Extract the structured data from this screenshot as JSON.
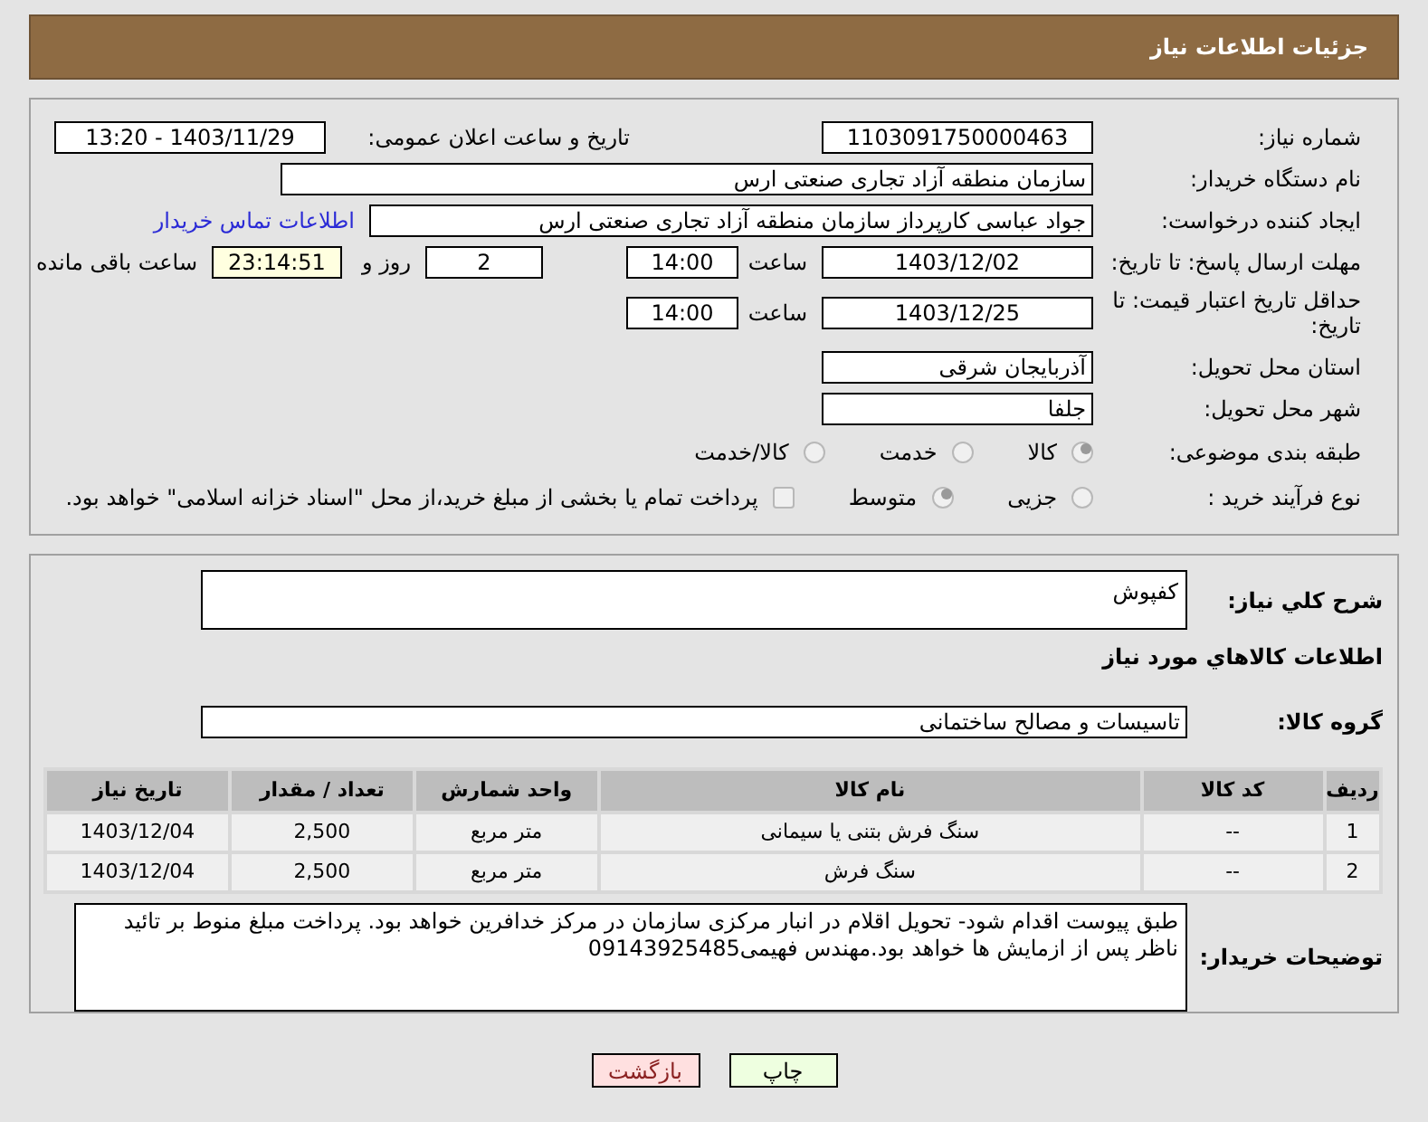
{
  "header": {
    "title": "جزئیات اطلاعات نیاز"
  },
  "need_number": {
    "label": "شماره نیاز:",
    "value": "1103091750000463"
  },
  "announce": {
    "label": "تاریخ و ساعت اعلان عمومی:",
    "value": "1403/11/29 - 13:20"
  },
  "buyer_org": {
    "label": "نام دستگاه خریدار:",
    "value": "سازمان منطقه آزاد تجاری صنعتی ارس"
  },
  "requester": {
    "label": "ایجاد کننده درخواست:",
    "value": "جواد عباسی کارپرداز سازمان منطقه آزاد تجاری صنعتی ارس",
    "link": "اطلاعات تماس خریدار"
  },
  "reply_deadline": {
    "label": "مهلت ارسال پاسخ: تا تاریخ:",
    "date": "1403/12/02",
    "time_label": "ساعت",
    "time": "14:00",
    "days": "2",
    "days_label": "روز و",
    "remaining": "23:14:51",
    "remaining_label": "ساعت باقی مانده"
  },
  "price_validity": {
    "label": "حداقل تاریخ اعتبار قیمت: تا تاریخ:",
    "date": "1403/12/25",
    "time_label": "ساعت",
    "time": "14:00"
  },
  "province": {
    "label": "استان محل تحویل:",
    "value": "آذربایجان شرقی"
  },
  "city": {
    "label": "شهر محل تحویل:",
    "value": "جلفا"
  },
  "category": {
    "label": "طبقه بندی موضوعی:",
    "options": [
      {
        "label": "کالا",
        "selected": true
      },
      {
        "label": "خدمت",
        "selected": false
      },
      {
        "label": "کالا/خدمت",
        "selected": false
      }
    ]
  },
  "process": {
    "label": "نوع فرآیند خرید :",
    "options": [
      {
        "label": "جزیی",
        "selected": false
      },
      {
        "label": "متوسط",
        "selected": true
      }
    ],
    "treasury": {
      "label": "پرداخت تمام یا بخشی از مبلغ خرید،از محل \"اسناد خزانه اسلامی\" خواهد بود.",
      "checked": false
    }
  },
  "description": {
    "label": "شرح کلي نياز:",
    "value": "کفپوش"
  },
  "goods_heading": "اطلاعات كالاهاي مورد نياز",
  "goods_group": {
    "label": "گروه کالا:",
    "value": "تاسیسات و مصالح ساختمانی"
  },
  "table": {
    "columns": [
      "ردیف",
      "کد کالا",
      "نام کالا",
      "واحد شمارش",
      "تعداد / مقدار",
      "تاریخ نیاز"
    ],
    "rows": [
      [
        "1",
        "--",
        "سنگ فرش بتنی یا سیمانی",
        "متر مربع",
        "2,500",
        "1403/12/04"
      ],
      [
        "2",
        "--",
        "سنگ فرش",
        "متر مربع",
        "2,500",
        "1403/12/04"
      ]
    ]
  },
  "buyer_notes": {
    "label": "توضیحات خریدار:",
    "value": "طبق پیوست اقدام شود- تحویل اقلام در انبار مرکزی سازمان  در مرکز خدافرین خواهد بود. پرداخت مبلغ منوط بر تائید ناظر پس از ازمایش ها خواهد بود.مهندس فهیمی09143925485"
  },
  "buttons": [
    {
      "label": "چاپ",
      "kind": "print"
    },
    {
      "label": "بازگشت",
      "kind": "back"
    }
  ]
}
